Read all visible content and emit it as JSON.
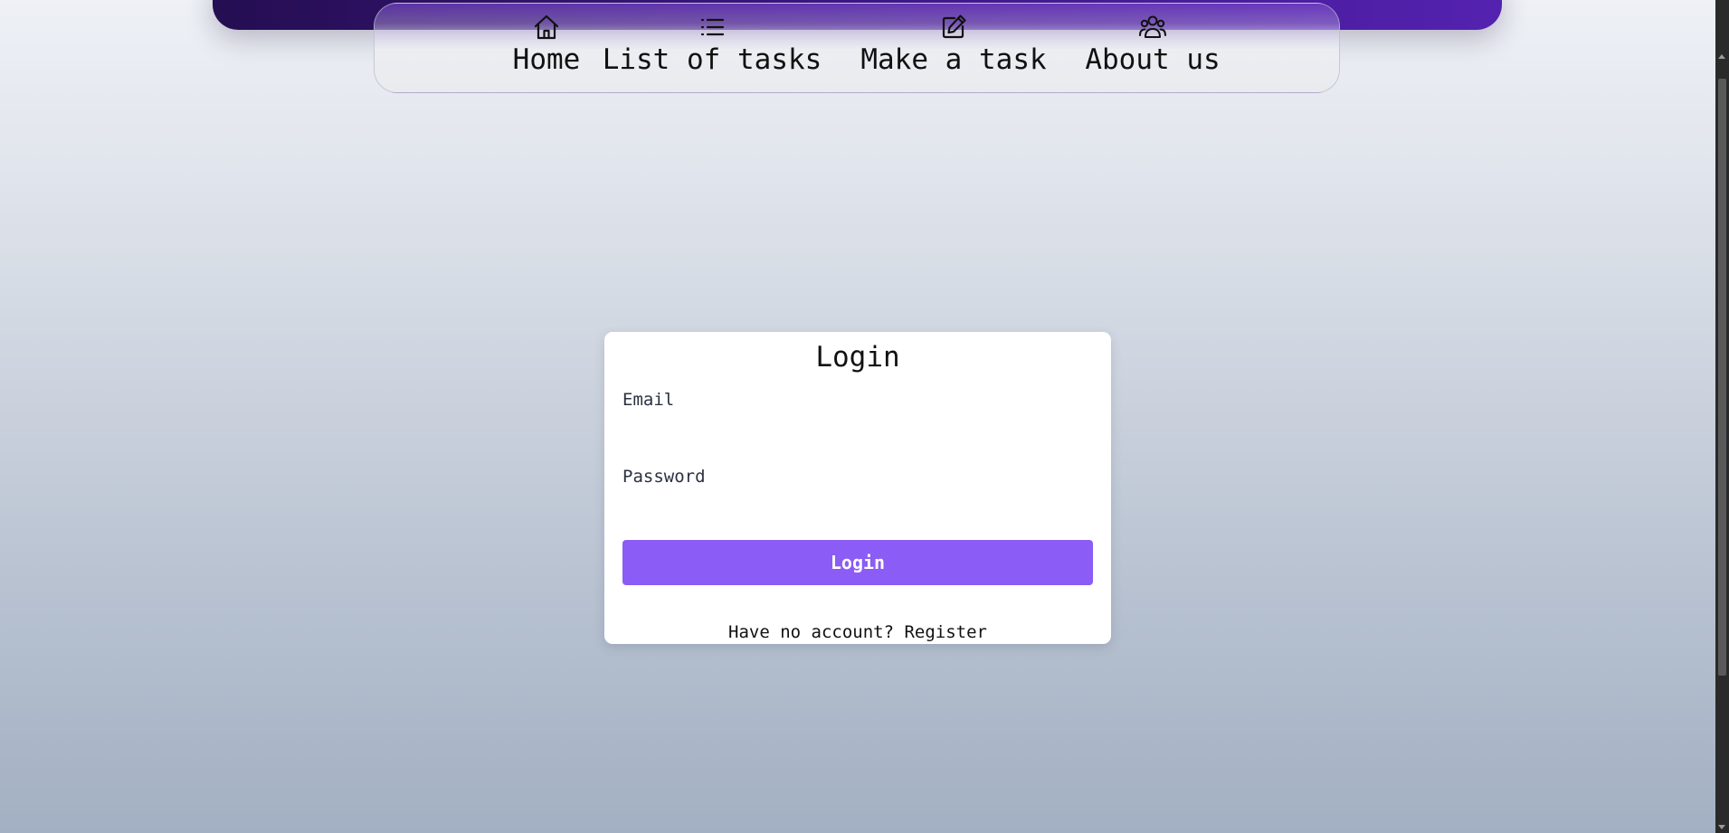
{
  "nav": {
    "items": [
      {
        "label": "Home",
        "icon": "home-icon"
      },
      {
        "label": "List of tasks",
        "icon": "list-icon"
      },
      {
        "label": "Make a task",
        "icon": "edit-icon"
      },
      {
        "label": "About us",
        "icon": "users-icon"
      }
    ]
  },
  "login": {
    "title": "Login",
    "email_label": "Email",
    "email_value": "",
    "password_label": "Password",
    "password_value": "",
    "button_label": "Login",
    "no_account_text": "Have no account?",
    "register_link": "Register"
  },
  "colors": {
    "accent": "#8b5cf6",
    "header_gradient_start": "#250e52",
    "header_gradient_end": "#5422b0"
  }
}
